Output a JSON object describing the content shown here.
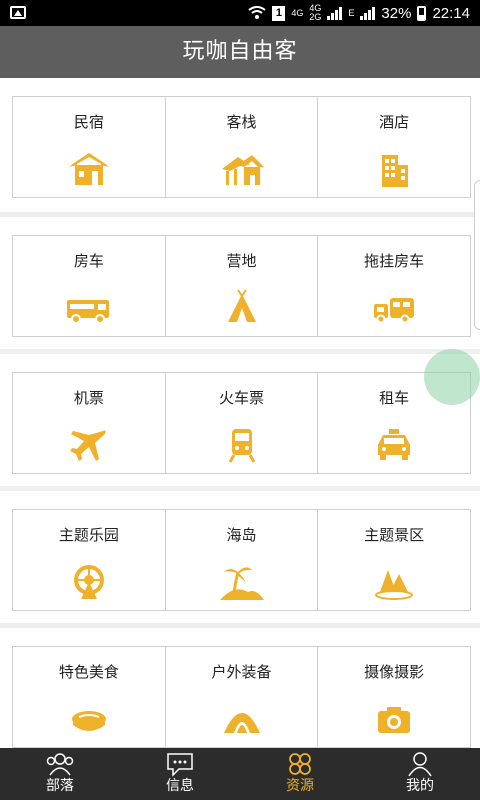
{
  "status_bar": {
    "network_4g": "4G",
    "network_4g_small": "4G",
    "network_2g_small": "2G",
    "network_e": "E",
    "sim_slot": "1",
    "battery": "32%",
    "time": "22:14"
  },
  "header": {
    "title": "玩咖自由客"
  },
  "accent_color": "#f0b12a",
  "sections": [
    {
      "items": [
        {
          "label": "民宿",
          "icon": "guesthouse-icon"
        },
        {
          "label": "客栈",
          "icon": "inn-icon"
        },
        {
          "label": "酒店",
          "icon": "hotel-icon"
        }
      ]
    },
    {
      "items": [
        {
          "label": "房车",
          "icon": "rv-icon"
        },
        {
          "label": "营地",
          "icon": "tent-icon"
        },
        {
          "label": "拖挂房车",
          "icon": "trailer-rv-icon"
        }
      ]
    },
    {
      "items": [
        {
          "label": "机票",
          "icon": "airplane-icon"
        },
        {
          "label": "火车票",
          "icon": "train-icon"
        },
        {
          "label": "租车",
          "icon": "taxi-icon"
        }
      ]
    },
    {
      "items": [
        {
          "label": "主题乐园",
          "icon": "ferris-wheel-icon"
        },
        {
          "label": "海岛",
          "icon": "island-icon"
        },
        {
          "label": "主题景区",
          "icon": "scenic-area-icon"
        }
      ]
    },
    {
      "items": [
        {
          "label": "特色美食",
          "icon": "food-icon"
        },
        {
          "label": "户外装备",
          "icon": "outdoor-gear-icon"
        },
        {
          "label": "摄像摄影",
          "icon": "camera-icon"
        }
      ]
    }
  ],
  "tabbar": {
    "items": [
      {
        "label": "部落",
        "icon": "people-icon",
        "active": false
      },
      {
        "label": "信息",
        "icon": "message-icon",
        "active": false
      },
      {
        "label": "资源",
        "icon": "clover-icon",
        "active": true
      },
      {
        "label": "我的",
        "icon": "profile-icon",
        "active": false
      }
    ]
  }
}
